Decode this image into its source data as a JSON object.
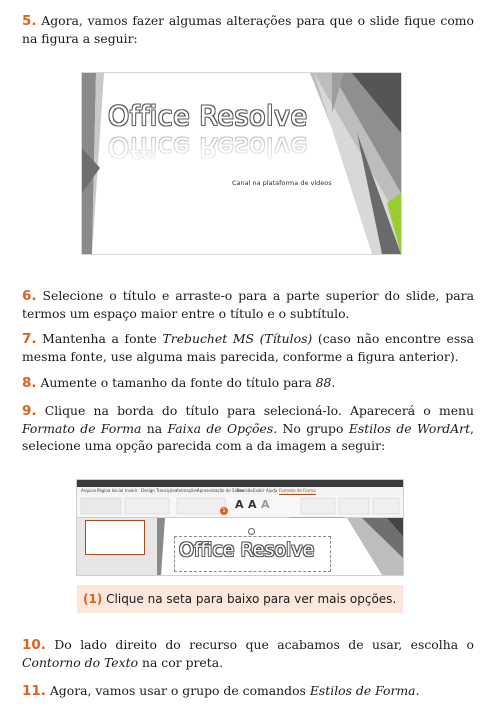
{
  "steps": [
    {
      "num": "5.",
      "text": " Agora, vamos fazer algumas alterações para que o slide fique como na figura a seguir:"
    },
    {
      "num": "6.",
      "text": " Selecione o título e arraste-o para a parte superior do slide, para termos um espaço maior entre o título e o subtítulo."
    },
    {
      "num": "7.",
      "pre": " Mantenha a fonte ",
      "italic": "Trebuchet MS (Títulos)",
      "post": " (caso não encontre essa mesma fonte, use alguma mais parecida, conforme a figura anterior)."
    },
    {
      "num": "8.",
      "pre": " Aumente o tamanho da fonte do título para ",
      "italic": "88",
      "post": "."
    },
    {
      "num": "9.",
      "pre": " Clique na borda do título para selecioná-lo. Aparecerá o menu ",
      "italic1": "Formato de Forma",
      "mid1": " na ",
      "italic2": "Faixa de Opções",
      "mid2": ". No grupo ",
      "italic3": "Estilos de WordArt",
      "post": ", selecione uma opção parecida com a da imagem a seguir:"
    },
    {
      "num": "10.",
      "pre": " Do lado direito do recurso que acabamos de usar, escolha o ",
      "italic": "Contorno do Texto",
      "post": " na cor preta."
    },
    {
      "num": "11.",
      "pre": " Agora, vamos usar o grupo de comandos ",
      "italic": "Estilos de Forma",
      "post": "."
    }
  ],
  "figure1": {
    "title": "Office Resolve",
    "subtitle": "Canal na plataforma de vídeos"
  },
  "figure2": {
    "title": "Office Resolve",
    "callout_marker": "1",
    "tabs": [
      "Arquivo",
      "Página Inicial",
      "Inserir",
      "Design",
      "Transições",
      "Animações",
      "Apresentação de Slides",
      "Revisão",
      "Exibir",
      "Ajuda",
      "Formato de Forma"
    ],
    "active_tab": "Formato de Forma"
  },
  "note": {
    "num": "(1)",
    "text": " Clique na seta para baixo para ver mais opções."
  },
  "colors": {
    "accent": "#e0611f",
    "note_bg": "#fbe7dc"
  }
}
